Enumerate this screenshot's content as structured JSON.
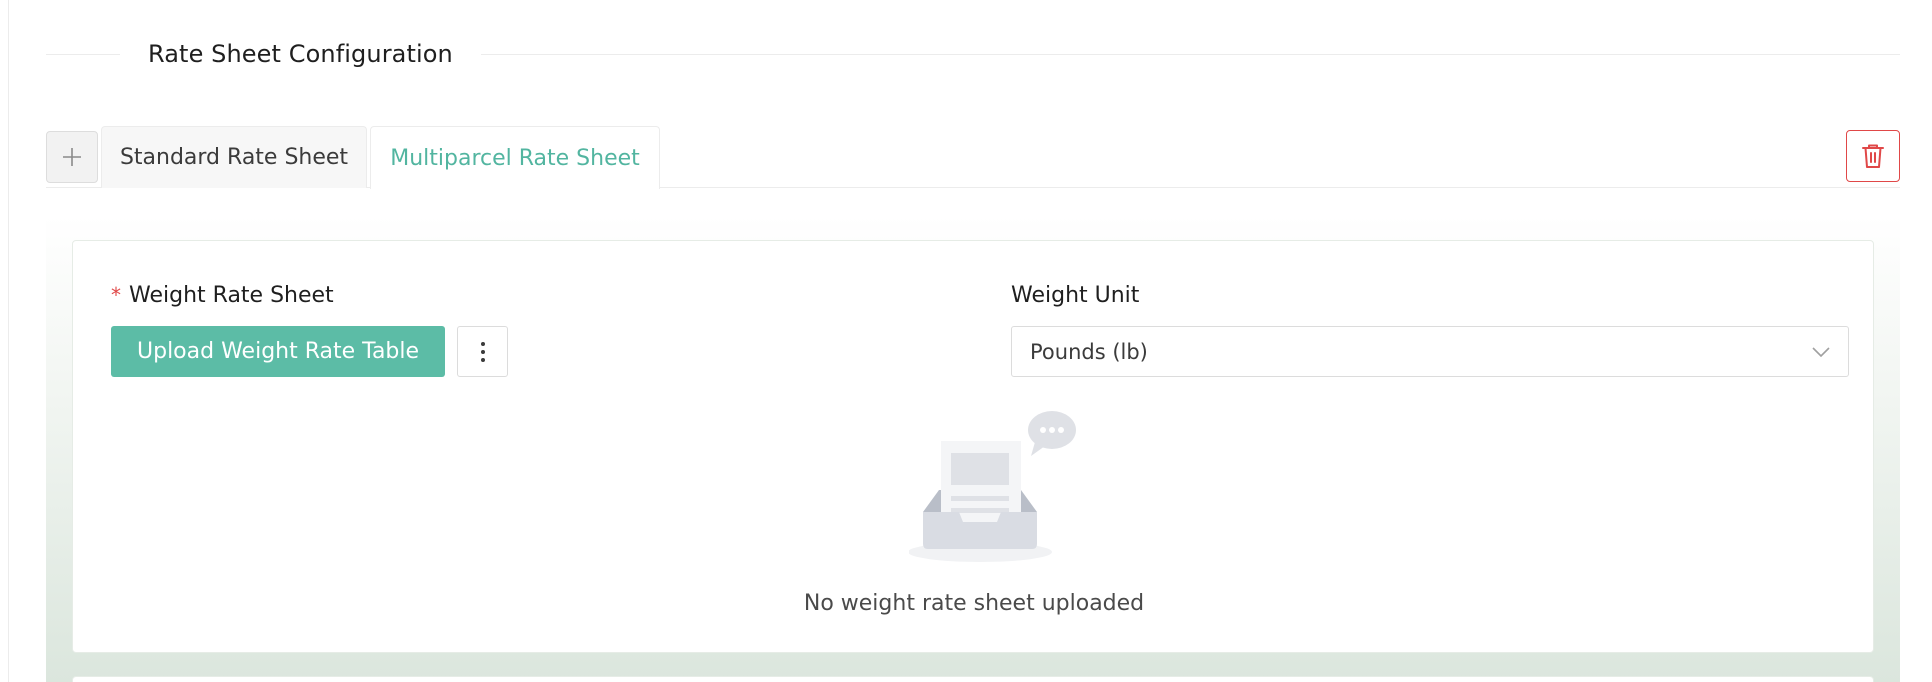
{
  "section": {
    "title": "Rate Sheet Configuration"
  },
  "tabs": {
    "add_icon": "plus-icon",
    "items": [
      {
        "label": "Standard Rate Sheet",
        "active": false
      },
      {
        "label": "Multiparcel Rate Sheet",
        "active": true
      }
    ],
    "delete_icon": "trash-icon"
  },
  "form": {
    "weight_rate_sheet": {
      "required_mark": "*",
      "label": "Weight Rate Sheet",
      "upload_button": "Upload Weight Rate Table",
      "more_icon": "more-vertical-icon"
    },
    "weight_unit": {
      "label": "Weight Unit",
      "value": "Pounds (lb)",
      "dropdown_icon": "chevron-down-icon"
    },
    "empty_state": {
      "icon": "empty-inbox-icon",
      "message": "No weight rate sheet uploaded"
    }
  },
  "colors": {
    "accent": "#52b5a0",
    "button": "#5cbca6",
    "danger": "#e04848"
  }
}
